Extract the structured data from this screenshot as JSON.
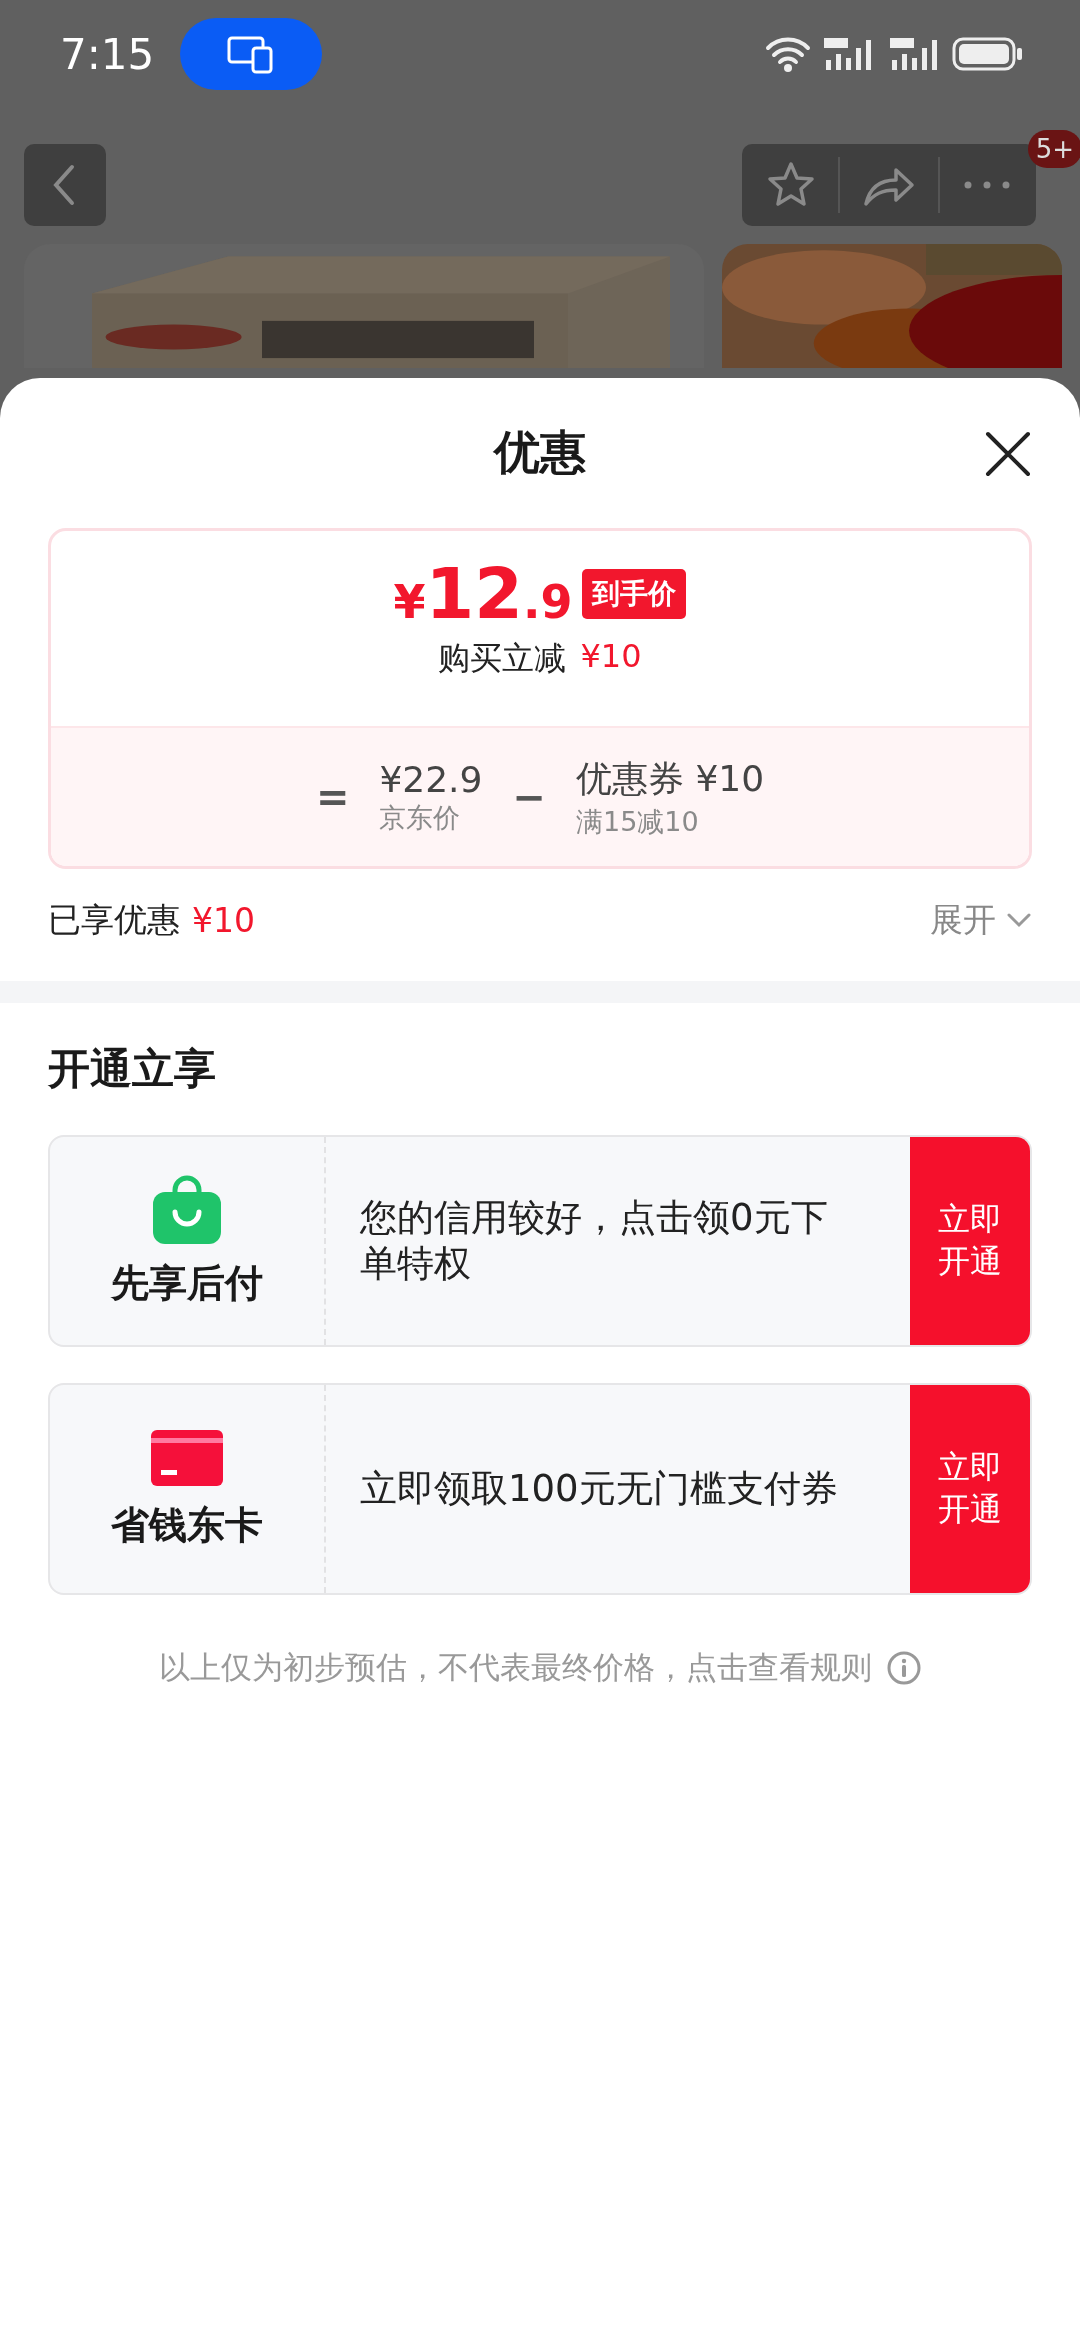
{
  "status_bar": {
    "time": "7:15"
  },
  "nav": {
    "badge": "5+"
  },
  "sheet": {
    "title": "优惠",
    "price": {
      "currency": "¥",
      "integer": "12",
      "decimal": ".9",
      "tag": "到手价",
      "subtitle": "购买立减",
      "subtitle_amount": "¥10"
    },
    "breakdown": {
      "equals": "=",
      "base_price": "¥22.9",
      "base_label": "京东价",
      "minus": "−",
      "coupon": "优惠券 ¥10",
      "coupon_rule": "满15减10"
    },
    "enjoyed": {
      "label": "已享优惠",
      "amount": "¥10"
    },
    "expand": "展开",
    "section_title": "开通立享",
    "offers": [
      {
        "kind": "bag",
        "name": "先享后付",
        "text": "您的信用较好，点击领0元下单特权",
        "button": "立即开通"
      },
      {
        "kind": "card",
        "name": "省钱东卡",
        "text": "立即领取100元无门槛支付券",
        "button": "立即开通"
      }
    ],
    "footer": "以上仅为初步预估，不代表最终价格，点击查看规则"
  }
}
